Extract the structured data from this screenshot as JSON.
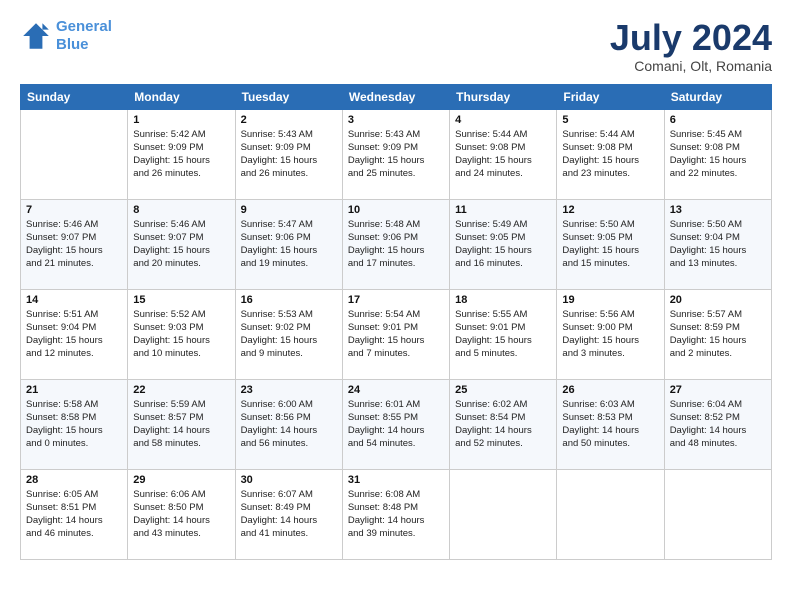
{
  "logo": {
    "line1": "General",
    "line2": "Blue"
  },
  "title": "July 2024",
  "location": "Comani, Olt, Romania",
  "weekdays": [
    "Sunday",
    "Monday",
    "Tuesday",
    "Wednesday",
    "Thursday",
    "Friday",
    "Saturday"
  ],
  "weeks": [
    [
      {
        "day": "",
        "info": ""
      },
      {
        "day": "1",
        "info": "Sunrise: 5:42 AM\nSunset: 9:09 PM\nDaylight: 15 hours\nand 26 minutes."
      },
      {
        "day": "2",
        "info": "Sunrise: 5:43 AM\nSunset: 9:09 PM\nDaylight: 15 hours\nand 26 minutes."
      },
      {
        "day": "3",
        "info": "Sunrise: 5:43 AM\nSunset: 9:09 PM\nDaylight: 15 hours\nand 25 minutes."
      },
      {
        "day": "4",
        "info": "Sunrise: 5:44 AM\nSunset: 9:08 PM\nDaylight: 15 hours\nand 24 minutes."
      },
      {
        "day": "5",
        "info": "Sunrise: 5:44 AM\nSunset: 9:08 PM\nDaylight: 15 hours\nand 23 minutes."
      },
      {
        "day": "6",
        "info": "Sunrise: 5:45 AM\nSunset: 9:08 PM\nDaylight: 15 hours\nand 22 minutes."
      }
    ],
    [
      {
        "day": "7",
        "info": "Sunrise: 5:46 AM\nSunset: 9:07 PM\nDaylight: 15 hours\nand 21 minutes."
      },
      {
        "day": "8",
        "info": "Sunrise: 5:46 AM\nSunset: 9:07 PM\nDaylight: 15 hours\nand 20 minutes."
      },
      {
        "day": "9",
        "info": "Sunrise: 5:47 AM\nSunset: 9:06 PM\nDaylight: 15 hours\nand 19 minutes."
      },
      {
        "day": "10",
        "info": "Sunrise: 5:48 AM\nSunset: 9:06 PM\nDaylight: 15 hours\nand 17 minutes."
      },
      {
        "day": "11",
        "info": "Sunrise: 5:49 AM\nSunset: 9:05 PM\nDaylight: 15 hours\nand 16 minutes."
      },
      {
        "day": "12",
        "info": "Sunrise: 5:50 AM\nSunset: 9:05 PM\nDaylight: 15 hours\nand 15 minutes."
      },
      {
        "day": "13",
        "info": "Sunrise: 5:50 AM\nSunset: 9:04 PM\nDaylight: 15 hours\nand 13 minutes."
      }
    ],
    [
      {
        "day": "14",
        "info": "Sunrise: 5:51 AM\nSunset: 9:04 PM\nDaylight: 15 hours\nand 12 minutes."
      },
      {
        "day": "15",
        "info": "Sunrise: 5:52 AM\nSunset: 9:03 PM\nDaylight: 15 hours\nand 10 minutes."
      },
      {
        "day": "16",
        "info": "Sunrise: 5:53 AM\nSunset: 9:02 PM\nDaylight: 15 hours\nand 9 minutes."
      },
      {
        "day": "17",
        "info": "Sunrise: 5:54 AM\nSunset: 9:01 PM\nDaylight: 15 hours\nand 7 minutes."
      },
      {
        "day": "18",
        "info": "Sunrise: 5:55 AM\nSunset: 9:01 PM\nDaylight: 15 hours\nand 5 minutes."
      },
      {
        "day": "19",
        "info": "Sunrise: 5:56 AM\nSunset: 9:00 PM\nDaylight: 15 hours\nand 3 minutes."
      },
      {
        "day": "20",
        "info": "Sunrise: 5:57 AM\nSunset: 8:59 PM\nDaylight: 15 hours\nand 2 minutes."
      }
    ],
    [
      {
        "day": "21",
        "info": "Sunrise: 5:58 AM\nSunset: 8:58 PM\nDaylight: 15 hours\nand 0 minutes."
      },
      {
        "day": "22",
        "info": "Sunrise: 5:59 AM\nSunset: 8:57 PM\nDaylight: 14 hours\nand 58 minutes."
      },
      {
        "day": "23",
        "info": "Sunrise: 6:00 AM\nSunset: 8:56 PM\nDaylight: 14 hours\nand 56 minutes."
      },
      {
        "day": "24",
        "info": "Sunrise: 6:01 AM\nSunset: 8:55 PM\nDaylight: 14 hours\nand 54 minutes."
      },
      {
        "day": "25",
        "info": "Sunrise: 6:02 AM\nSunset: 8:54 PM\nDaylight: 14 hours\nand 52 minutes."
      },
      {
        "day": "26",
        "info": "Sunrise: 6:03 AM\nSunset: 8:53 PM\nDaylight: 14 hours\nand 50 minutes."
      },
      {
        "day": "27",
        "info": "Sunrise: 6:04 AM\nSunset: 8:52 PM\nDaylight: 14 hours\nand 48 minutes."
      }
    ],
    [
      {
        "day": "28",
        "info": "Sunrise: 6:05 AM\nSunset: 8:51 PM\nDaylight: 14 hours\nand 46 minutes."
      },
      {
        "day": "29",
        "info": "Sunrise: 6:06 AM\nSunset: 8:50 PM\nDaylight: 14 hours\nand 43 minutes."
      },
      {
        "day": "30",
        "info": "Sunrise: 6:07 AM\nSunset: 8:49 PM\nDaylight: 14 hours\nand 41 minutes."
      },
      {
        "day": "31",
        "info": "Sunrise: 6:08 AM\nSunset: 8:48 PM\nDaylight: 14 hours\nand 39 minutes."
      },
      {
        "day": "",
        "info": ""
      },
      {
        "day": "",
        "info": ""
      },
      {
        "day": "",
        "info": ""
      }
    ]
  ]
}
